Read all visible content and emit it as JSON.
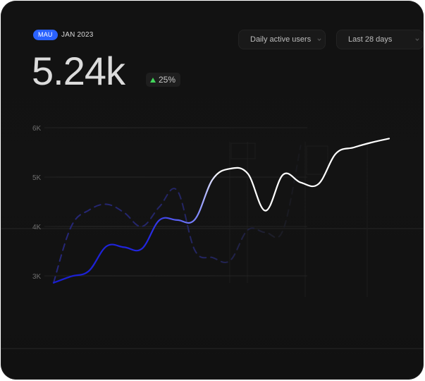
{
  "header": {
    "badge": "MAU",
    "period": "JAN 2023",
    "value": "5.24k",
    "change": "25%",
    "change_color": "#42d65b"
  },
  "controls": {
    "metric": "Daily active users",
    "range": "Last 28 days"
  },
  "colors": {
    "accent": "#2a62ff",
    "current_line_start": "#1a1fd0",
    "current_line_end": "#ffffff",
    "previous_line": "#26276e"
  },
  "chart_data": {
    "type": "line",
    "title": "",
    "xlabel": "",
    "ylabel": "",
    "y_ticks": [
      "6K",
      "5K",
      "4K",
      "3K"
    ],
    "y_tick_values": [
      6000,
      5000,
      4000,
      3000
    ],
    "ylim": [
      2700,
      6200
    ],
    "x": [
      1,
      2,
      3,
      4,
      5,
      6,
      7,
      8,
      9,
      10,
      11,
      12,
      13,
      14,
      15,
      16,
      17,
      18,
      19,
      20
    ],
    "series": [
      {
        "name": "",
        "style": "solid",
        "values": [
          2860,
          2990,
          3100,
          3600,
          3580,
          3550,
          4130,
          4130,
          4140,
          4950,
          5170,
          5070,
          4320,
          5050,
          4890,
          4860,
          5480,
          5600,
          5700,
          5780
        ]
      },
      {
        "name": "",
        "style": "dashed",
        "values": [
          2860,
          4000,
          4330,
          4450,
          4280,
          4000,
          4400,
          4730,
          3520,
          3370,
          3310,
          3930,
          3880,
          3930,
          5640
        ]
      }
    ],
    "grid": true,
    "legend": "none"
  }
}
